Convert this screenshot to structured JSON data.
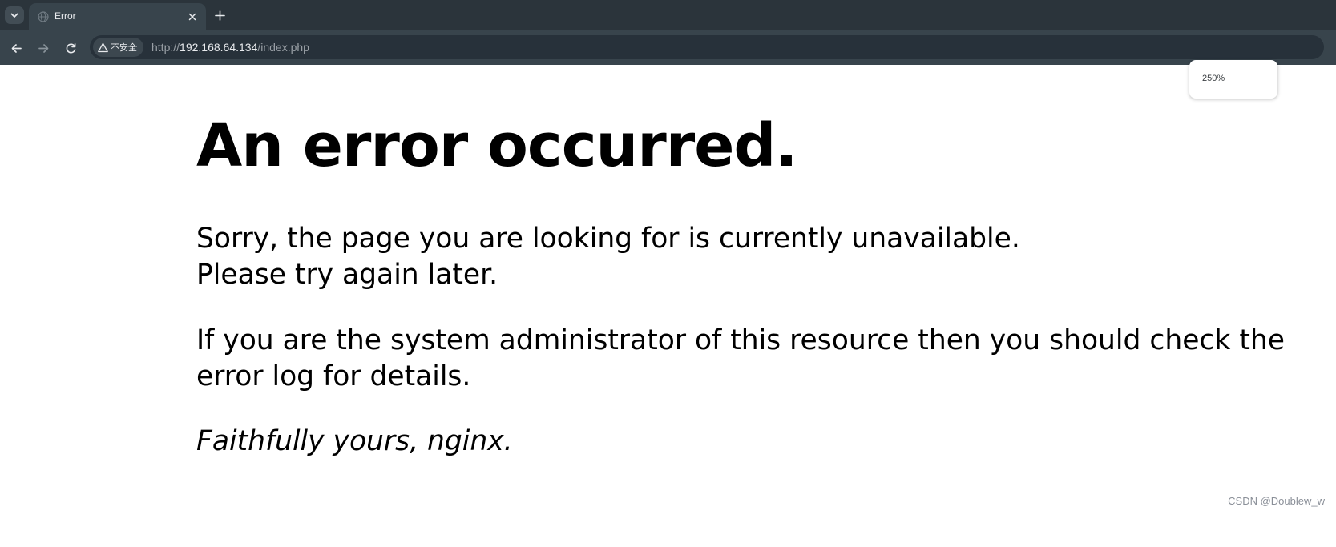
{
  "browser": {
    "tab": {
      "title": "Error",
      "favicon": "globe-icon"
    },
    "address_bar": {
      "security_label": "不安全",
      "url_scheme": "http://",
      "url_host": "192.168.64.134",
      "url_path": "/index.php"
    },
    "zoom_level": "250%"
  },
  "page": {
    "heading": "An error occurred.",
    "paragraph1_line1": "Sorry, the page you are looking for is currently unavailable.",
    "paragraph1_line2": "Please try again later.",
    "paragraph2_line1": "If you are the system administrator of this resource then you should check the",
    "paragraph2_line2": "error log for details.",
    "signature": "Faithfully yours, nginx."
  },
  "watermark": "CSDN @Doublew_w",
  "colors": {
    "tabstrip_bg": "#2b343b",
    "toolbar_bg": "#38444c",
    "omnibox_bg": "#27313a",
    "page_bg": "#ffffff",
    "text": "#000000"
  }
}
